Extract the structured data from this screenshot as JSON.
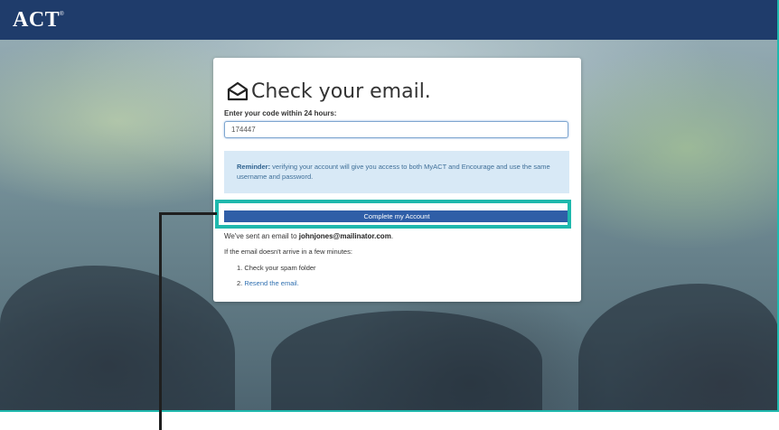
{
  "header": {
    "logo_text": "ACT",
    "logo_mark": "®",
    "background_color": "#1f3c6b"
  },
  "card": {
    "title": "Check your email.",
    "title_icon": "envelope-open-icon",
    "code_label": "Enter your code within 24 hours:",
    "code_value": "174447",
    "reminder_bold": "Reminder:",
    "reminder_text": " verifying your account will give you access to both MyACT and Encourage and use the same username and password.",
    "complete_button_label": "Complete my Account",
    "sent_prefix": "We've sent an email to ",
    "sent_email": "johnjones@mailinator.com",
    "sent_suffix": ".",
    "arrive_text": "If the email doesn't arrive in a few minutes:",
    "step1_text": "1. Check your spam folder",
    "step2_prefix": "2. ",
    "step2_link": "Resend the email",
    "step2_suffix": "."
  },
  "colors": {
    "accent_highlight": "#1fb8ad",
    "button": "#2f5ea7",
    "reminder_bg": "#d8e9f6",
    "link": "#2f6fb0"
  }
}
